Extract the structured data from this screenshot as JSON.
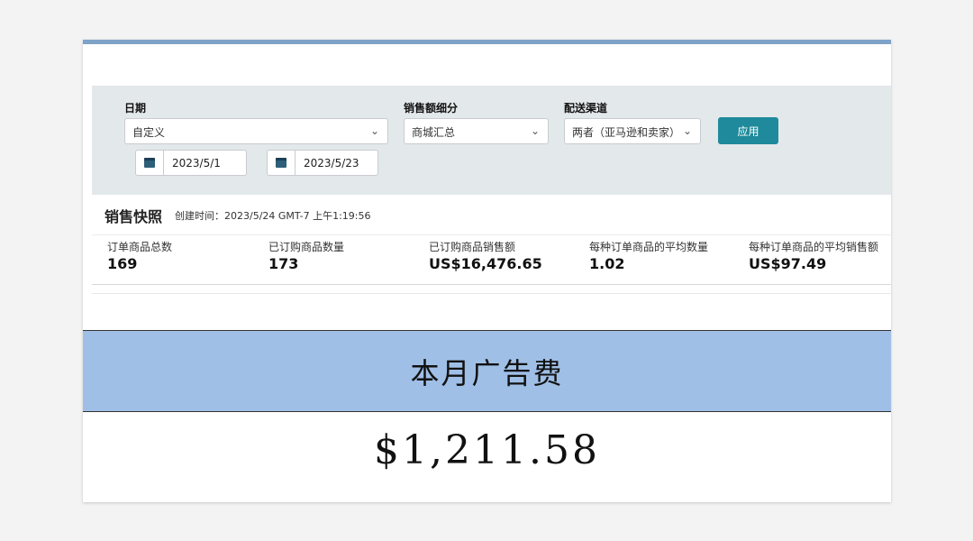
{
  "filters": {
    "date_label": "日期",
    "date_select_value": "自定义",
    "start_date": "2023/5/1",
    "end_date": "2023/5/23",
    "sales_breakdown_label": "销售额细分",
    "sales_breakdown_value": "商城汇总",
    "channel_label": "配送渠道",
    "channel_value": "两者（亚马逊和卖家）",
    "apply_label": "应用",
    "chevron_icon": "chevron-down-icon",
    "calendar_icon": "calendar-icon"
  },
  "snapshot": {
    "title": "销售快照",
    "created": "创建时间：2023/5/24 GMT-7 上午1:19:56",
    "metrics": [
      {
        "label": "订单商品总数",
        "value": "169"
      },
      {
        "label": "已订购商品数量",
        "value": "173"
      },
      {
        "label": "已订购商品销售额",
        "value": "US$16,476.65"
      },
      {
        "label": "每种订单商品的平均数量",
        "value": "1.02"
      },
      {
        "label": "每种订单商品的平均销售额",
        "value": "US$97.49"
      }
    ]
  },
  "ad_cost": {
    "title": "本月广告费",
    "amount": "$1,211.58"
  },
  "colors": {
    "accent_top_bar": "#7fa2c8",
    "apply_button": "#1f8a9b",
    "band": "#9fbfe6"
  }
}
